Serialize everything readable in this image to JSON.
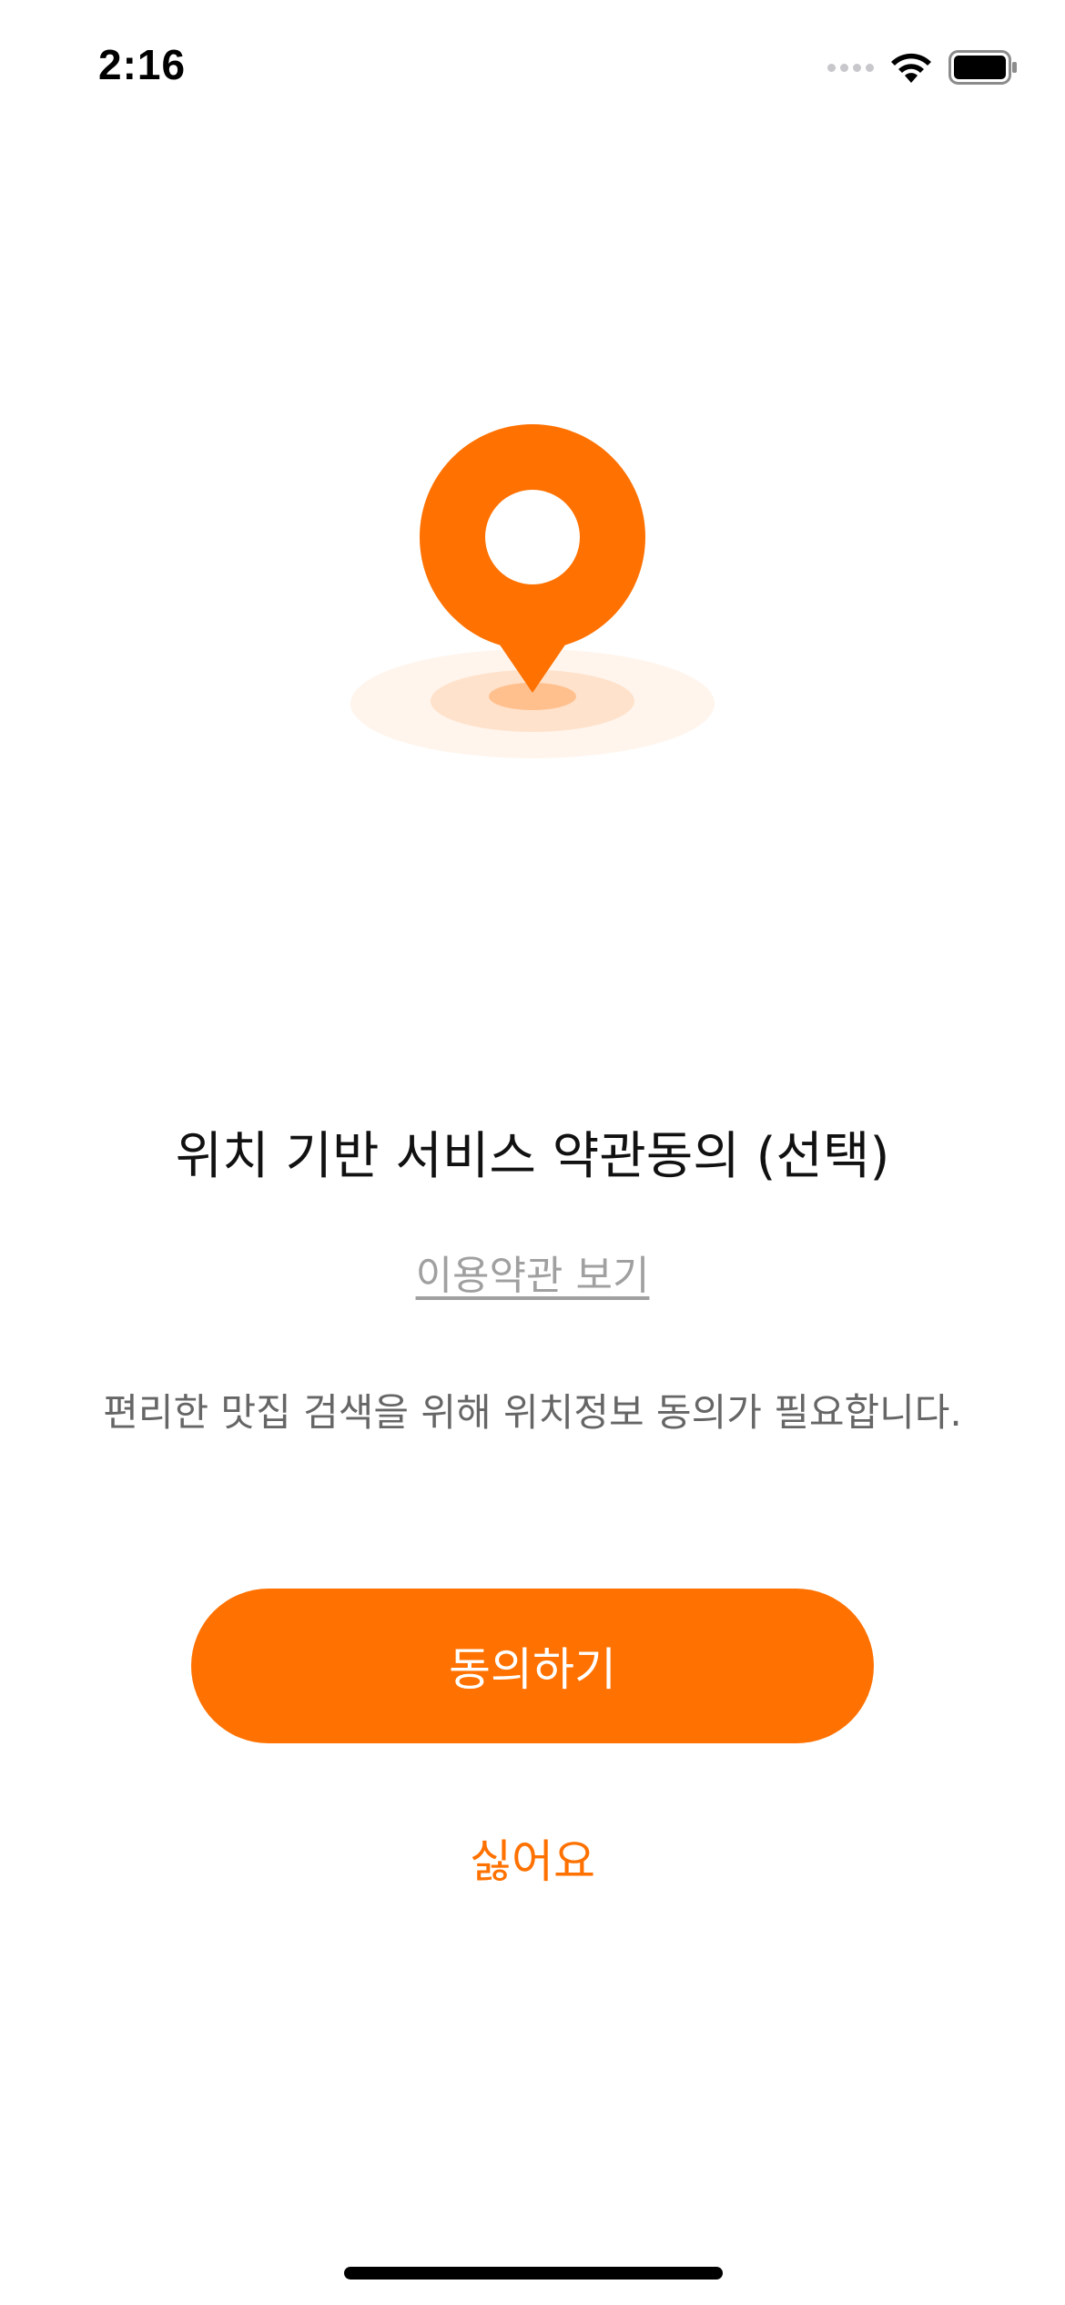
{
  "status_bar": {
    "time": "2:16",
    "icons": [
      "signal-dots-icon",
      "wifi-icon",
      "battery-icon"
    ]
  },
  "illustration": {
    "icon": "location-pin-icon",
    "colors": {
      "pin": "#ff7100",
      "ripple": "#ffe3cf"
    }
  },
  "consent": {
    "title": "위치 기반 서비스 약관동의 (선택)",
    "terms_link": "이용약관 보기",
    "description": "편리한 맛집 검색을 위해 위치정보 동의가 필요합니다.",
    "agree_label": "동의하기",
    "decline_label": "싫어요"
  },
  "colors": {
    "accent": "#ff7100",
    "secondary_text": "#666666",
    "link_text": "#a0a0a0"
  }
}
